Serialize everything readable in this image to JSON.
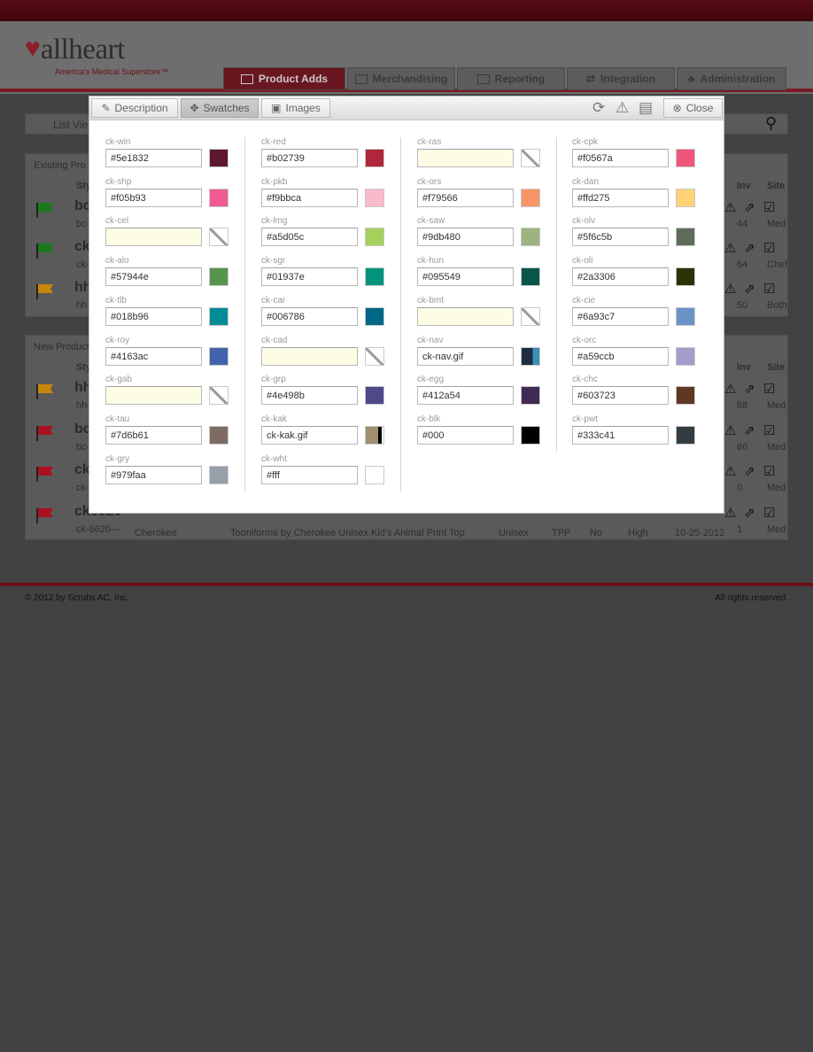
{
  "logo": {
    "brand": "allheart",
    "tagline": "America's Medical Superstore™"
  },
  "nav": {
    "tabs": [
      {
        "label": "Product Adds",
        "icon": "image-icon",
        "active": true
      },
      {
        "label": "Merchandising",
        "icon": "table-icon"
      },
      {
        "label": "Reporting",
        "icon": "bar-chart-icon"
      },
      {
        "label": "Integration",
        "icon": "shuffle-icon"
      },
      {
        "label": "Administration",
        "icon": "org-chart-icon"
      }
    ]
  },
  "background": {
    "list_view": "List Vie",
    "existing_section": "Existing Pro",
    "new_section": "New Product",
    "col_style": "Sty",
    "col_inv": "Inv",
    "col_site": "Site",
    "existing_rows": [
      {
        "style": "bc",
        "sub": "bc-",
        "inv": "44",
        "site": "Med",
        "flag": "#1a7a1a"
      },
      {
        "style": "ck",
        "sub": "ck-",
        "inv": "64",
        "site": "Chef",
        "flag": "#1a7a1a"
      },
      {
        "style": "hh",
        "sub": "hh-",
        "inv": "50",
        "site": "Both",
        "flag": "#c8860a"
      }
    ],
    "new_rows": [
      {
        "style": "hh",
        "sub": "hh-",
        "inv": "88",
        "site": "Med",
        "flag": "#c8860a"
      },
      {
        "style": "bc",
        "sub": "bc-",
        "inv": "66",
        "site": "Med",
        "flag": "#aa1020"
      },
      {
        "style": "ck",
        "sub": "ck-",
        "inv": "0",
        "site": "Med",
        "flag": "#aa1020"
      },
      {
        "style": "ck6620",
        "sub": "ck-6620—",
        "inv": "1",
        "site": "Med",
        "flag": "#aa1020"
      }
    ],
    "last_row": {
      "brand": "Cherokee",
      "name": "Tooniforms by Cherokee Unisex Kid's Animal Print Top",
      "gender": "Unisex",
      "type": "TPP",
      "flag": "No",
      "level": "High",
      "date": "10-25-2012"
    }
  },
  "footer": {
    "copyright": "© 2012 by Scrubs AC, Inc.",
    "rights": "All rights reserved."
  },
  "modal": {
    "buttons": {
      "description": "Description",
      "swatches": "Swatches",
      "images": "Images",
      "close": "Close"
    },
    "columns": [
      [
        {
          "label": "ck-win",
          "value": "#5e1832",
          "color": "#5e1832"
        },
        {
          "label": "ck-shp",
          "value": "#f05b93",
          "color": "#f05b93"
        },
        {
          "label": "ck-cel",
          "value": "",
          "color": "none"
        },
        {
          "label": "ck-alo",
          "value": "#57944e",
          "color": "#57944e"
        },
        {
          "label": "ck-tlb",
          "value": "#018b96",
          "color": "#018b96"
        },
        {
          "label": "ck-roy",
          "value": "#4163ac",
          "color": "#4163ac"
        },
        {
          "label": "ck-gab",
          "value": "",
          "color": "none"
        },
        {
          "label": "ck-tau",
          "value": "#7d6b61",
          "color": "#7d6b61"
        },
        {
          "label": "ck-gry",
          "value": "#979faa",
          "color": "#979faa"
        }
      ],
      [
        {
          "label": "ck-red",
          "value": "#b02739",
          "color": "#b02739"
        },
        {
          "label": "ck-pkb",
          "value": "#f9bbca",
          "color": "#f9bbca"
        },
        {
          "label": "ck-lmg",
          "value": "#a5d05c",
          "color": "#a5d05c"
        },
        {
          "label": "ck-sgr",
          "value": "#01937e",
          "color": "#01937e"
        },
        {
          "label": "ck-car",
          "value": "#006786",
          "color": "#006786"
        },
        {
          "label": "ck-cad",
          "value": "",
          "color": "none"
        },
        {
          "label": "ck-grp",
          "value": "#4e498b",
          "color": "#4e498b"
        },
        {
          "label": "ck-kak",
          "value": "ck-kak.gif",
          "color": "img-kak"
        },
        {
          "label": "ck-wht",
          "value": "#fff",
          "color": "#ffffff"
        }
      ],
      [
        {
          "label": "ck-ras",
          "value": "",
          "color": "none"
        },
        {
          "label": "ck-ors",
          "value": "#f79566",
          "color": "#f79566"
        },
        {
          "label": "ck-saw",
          "value": "#9db480",
          "color": "#9db480"
        },
        {
          "label": "ck-hun",
          "value": "#095549",
          "color": "#095549"
        },
        {
          "label": "ck-bmt",
          "value": "",
          "color": "none"
        },
        {
          "label": "ck-nav",
          "value": "ck-nav.gif",
          "color": "img-nav"
        },
        {
          "label": "ck-egg",
          "value": "#412a54",
          "color": "#412a54"
        },
        {
          "label": "ck-blk",
          "value": "#000",
          "color": "#000000"
        }
      ],
      [
        {
          "label": "ck-cpk",
          "value": "#f0567a",
          "color": "#f0567a"
        },
        {
          "label": "ck-dan",
          "value": "#ffd275",
          "color": "#ffd275"
        },
        {
          "label": "ck-olv",
          "value": "#5f6c5b",
          "color": "#5f6c5b"
        },
        {
          "label": "ck-oli",
          "value": "#2a3306",
          "color": "#2a3306"
        },
        {
          "label": "ck-cie",
          "value": "#6a93c7",
          "color": "#6a93c7"
        },
        {
          "label": "ck-orc",
          "value": "#a59ccb",
          "color": "#a59ccb"
        },
        {
          "label": "ck-chc",
          "value": "#603723",
          "color": "#603723"
        },
        {
          "label": "ck-pwt",
          "value": "#333c41",
          "color": "#333c41"
        }
      ]
    ]
  }
}
